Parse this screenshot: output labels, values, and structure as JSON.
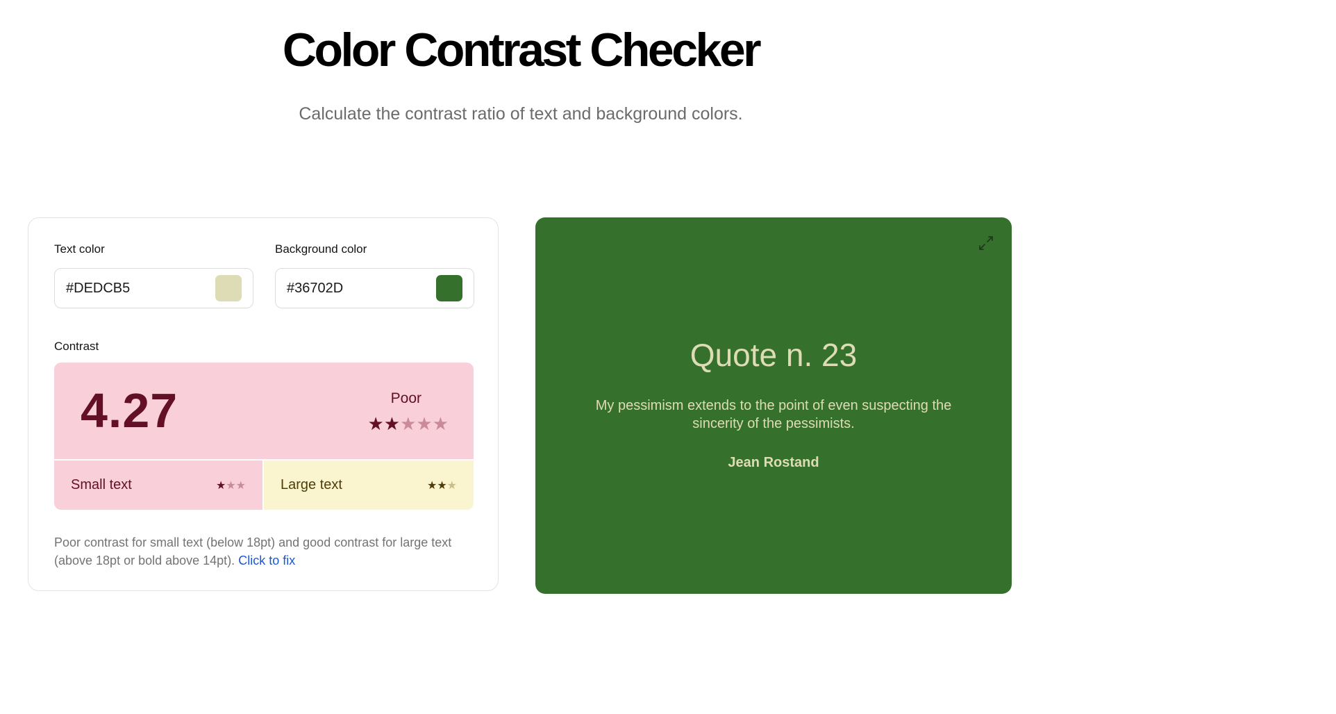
{
  "header": {
    "title": "Color Contrast Checker",
    "subtitle": "Calculate the contrast ratio of text and background colors."
  },
  "inputs": {
    "text_color_label": "Text color",
    "text_color_value": "#DEDCB5",
    "background_color_label": "Background color",
    "background_color_value": "#36702D"
  },
  "contrast": {
    "label": "Contrast",
    "ratio": "4.27",
    "rating": "Poor",
    "rating_stars": 2,
    "rating_stars_max": 5,
    "small_text_label": "Small text",
    "small_text_stars": 1,
    "large_text_label": "Large text",
    "large_text_stars": 2,
    "size_stars_max": 3,
    "note": "Poor contrast for small text (below 18pt) and good contrast for large text (above 18pt or bold above 14pt).",
    "fix_link": "Click to fix"
  },
  "preview": {
    "title": "Quote n. 23",
    "quote": "My pessimism extends to the point of even suspecting the sincerity of the pessimists.",
    "author": "Jean Rostand",
    "expand_icon": "expand-icon"
  },
  "colors": {
    "text_color": "#DEDCB5",
    "background_color": "#36702D",
    "poor_bg": "#F9D0D9",
    "poor_fg": "#630F25",
    "poor_star_off": "#C98A9A",
    "ok_bg": "#FBF5CF",
    "ok_fg": "#4F3D08",
    "ok_star_off": "#C9BE8A",
    "link": "#1A56DB"
  }
}
